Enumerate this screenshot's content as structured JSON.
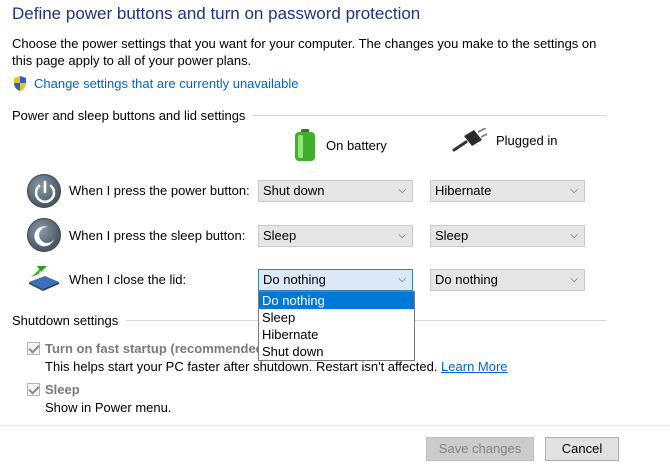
{
  "title": "Define power buttons and turn on password protection",
  "description": "Choose the power settings that you want for your computer. The changes you make to the settings on this page apply to all of your power plans.",
  "change_link": "Change settings that are currently unavailable",
  "section1": "Power and sleep buttons and lid settings",
  "columns": {
    "battery": "On battery",
    "plugged": "Plugged in"
  },
  "rows": [
    {
      "label": "When I press the power button:",
      "battery": "Shut down",
      "plugged": "Hibernate",
      "icon": "power-icon"
    },
    {
      "label": "When I press the sleep button:",
      "battery": "Sleep",
      "plugged": "Sleep",
      "icon": "sleep-icon"
    },
    {
      "label": "When I close the lid:",
      "battery": "Do nothing",
      "plugged": "Do nothing",
      "icon": "lid-icon"
    }
  ],
  "dropdown_options": [
    "Do nothing",
    "Sleep",
    "Hibernate",
    "Shut down"
  ],
  "section2": "Shutdown settings",
  "fast_startup": {
    "label": "Turn on fast startup (recommended)",
    "desc": "This helps start your PC faster after shutdown. Restart isn't affected.",
    "learn_more": "Learn More",
    "checked": true
  },
  "sleep_setting": {
    "label": "Sleep",
    "desc": "Show in Power menu.",
    "checked": true
  },
  "buttons": {
    "save": "Save changes",
    "cancel": "Cancel"
  },
  "colors": {
    "title": "#1e3287",
    "link": "#0066cc",
    "selected": "#0078d7"
  }
}
